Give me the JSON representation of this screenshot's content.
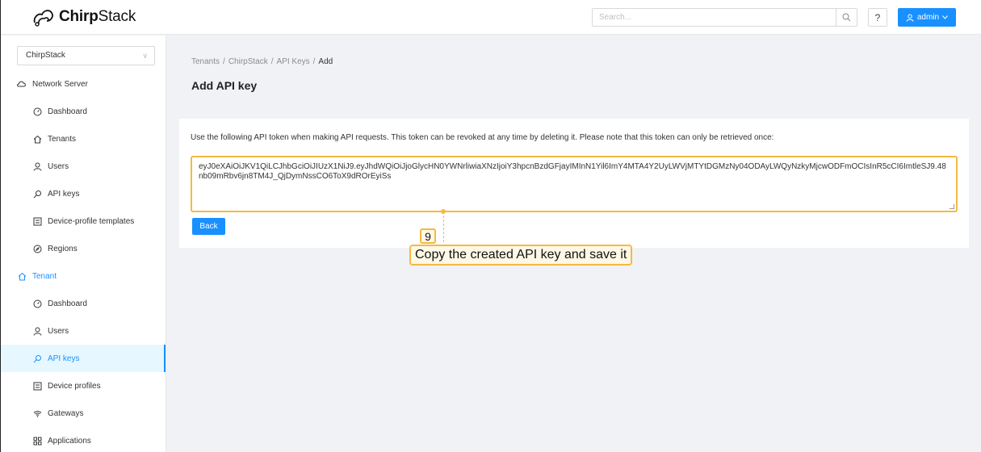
{
  "header": {
    "logo_bold": "Chirp",
    "logo_rest": "Stack",
    "search_placeholder": "Search...",
    "help_label": "?",
    "user_label": "admin"
  },
  "sidebar": {
    "tenant_select": "ChirpStack",
    "network_server_group": "Network Server",
    "network_server_items": [
      {
        "label": "Dashboard",
        "icon": "dashboard-icon"
      },
      {
        "label": "Tenants",
        "icon": "home-icon"
      },
      {
        "label": "Users",
        "icon": "user-icon"
      },
      {
        "label": "API keys",
        "icon": "key-icon"
      },
      {
        "label": "Device-profile templates",
        "icon": "template-icon"
      },
      {
        "label": "Regions",
        "icon": "compass-icon"
      }
    ],
    "tenant_group": "Tenant",
    "tenant_items": [
      {
        "label": "Dashboard",
        "icon": "dashboard-icon"
      },
      {
        "label": "Users",
        "icon": "user-icon"
      },
      {
        "label": "API keys",
        "icon": "key-icon",
        "active": true
      },
      {
        "label": "Device profiles",
        "icon": "profile-icon"
      },
      {
        "label": "Gateways",
        "icon": "wifi-icon"
      },
      {
        "label": "Applications",
        "icon": "apps-icon"
      }
    ]
  },
  "breadcrumb": [
    "Tenants",
    "ChirpStack",
    "API Keys",
    "Add"
  ],
  "page_title": "Add API key",
  "card": {
    "description": "Use the following API token when making API requests. This token can be revoked at any time by deleting it. Please note that this token can only be retrieved once:",
    "token": "eyJ0eXAiOiJKV1QiLCJhbGciOiJIUzX1NiJ9.eyJhdWQiOiJjoGlycHN0YWNrliwiaXNzIjoiY3hpcnBzdGFjayIMInN1Yil6ImY4MTA4Y2UyLWVjMTYtDGMzNy04ODAyLWQyNzkyMjcwODFmOCIsInR5cCI6ImtleSJ9.48nb09mRbv6jn8TM4J_QjDymNssCO6ToX9dROrEyiSs",
    "back_label": "Back"
  },
  "annotation": {
    "step": "9",
    "text": "Copy the created API key and save it"
  },
  "colors": {
    "primary": "#1890ff",
    "annotation": "#f5b942"
  }
}
